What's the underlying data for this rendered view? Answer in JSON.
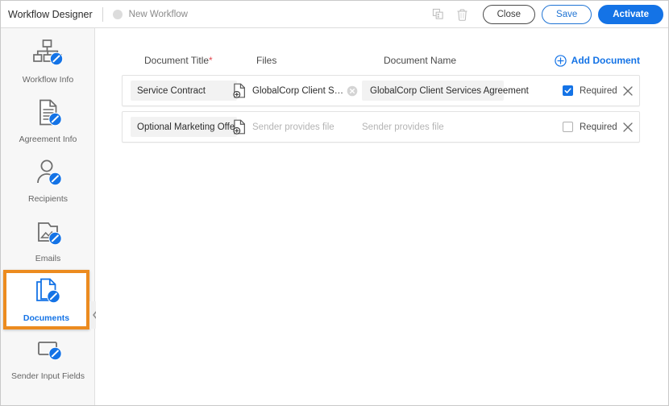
{
  "topbar": {
    "app_title": "Workflow Designer",
    "workflow_name": "New Workflow",
    "status_dot_color": "#dcdcdc",
    "copy_icon": "copy-icon",
    "delete_icon": "trash-icon",
    "close_label": "Close",
    "save_label": "Save",
    "activate_label": "Activate",
    "accent_color": "#1473e6"
  },
  "sidebar": {
    "highlight_color": "#ec8b1f",
    "items": [
      {
        "label": "Workflow Info",
        "icon": "workflow-info-icon",
        "active": false
      },
      {
        "label": "Agreement Info",
        "icon": "agreement-info-icon",
        "active": false
      },
      {
        "label": "Recipients",
        "icon": "recipients-icon",
        "active": false
      },
      {
        "label": "Emails",
        "icon": "emails-icon",
        "active": false
      },
      {
        "label": "Documents",
        "icon": "documents-icon",
        "active": true
      },
      {
        "label": "Sender Input Fields",
        "icon": "sender-input-fields-icon",
        "active": false
      }
    ],
    "collapse_icon": "chevron-left-icon"
  },
  "main": {
    "columns": {
      "document_title": "Document Title",
      "document_title_required_marker": "*",
      "files": "Files",
      "document_name": "Document Name"
    },
    "add_document_label": "Add Document",
    "required_label": "Required",
    "rows": [
      {
        "title": "Service Contract",
        "file_name": "GlobalCorp Client Servic...",
        "file_is_placeholder": false,
        "has_clear_file": true,
        "document_name": "GlobalCorp Client Services Agreement",
        "document_name_is_placeholder": false,
        "required": true
      },
      {
        "title": "Optional Marketing Offer",
        "file_name": "Sender provides file",
        "file_is_placeholder": true,
        "has_clear_file": false,
        "document_name": "Sender provides file",
        "document_name_is_placeholder": true,
        "required": false
      }
    ]
  }
}
